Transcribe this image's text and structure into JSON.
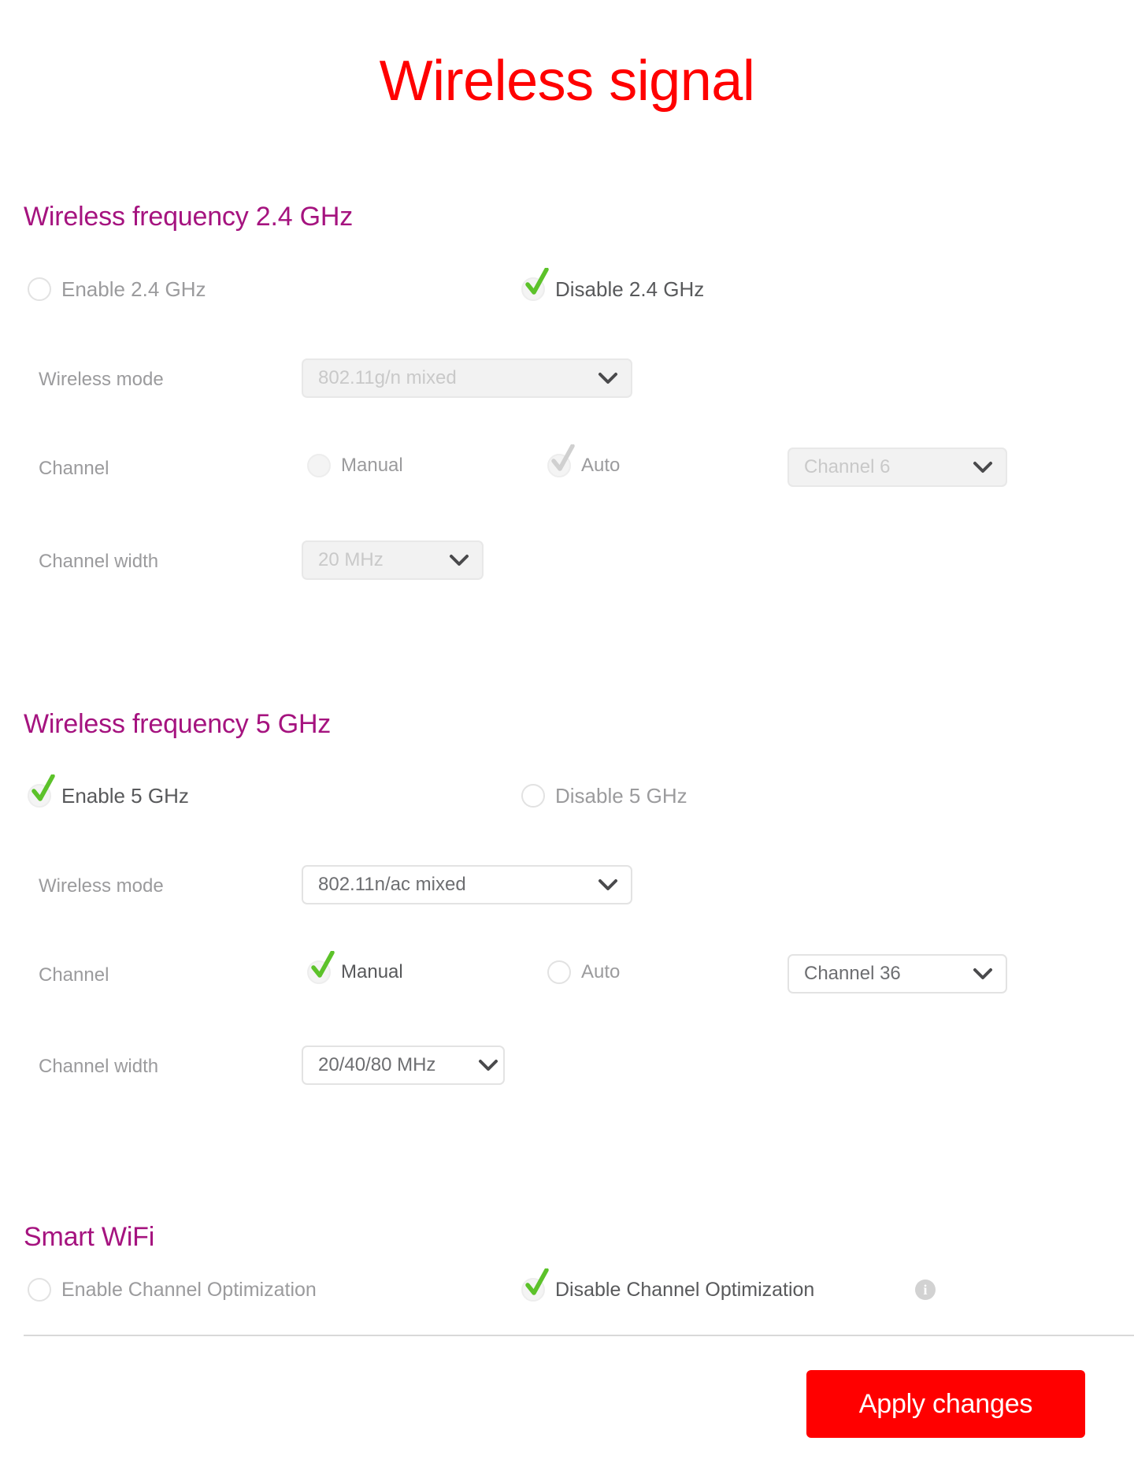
{
  "page": {
    "title": "Wireless signal"
  },
  "colors": {
    "title_red": "#ff0000",
    "heading_magenta": "#a5137f",
    "label_gray": "#58595b",
    "disabled_gray": "#c9c9c9",
    "check_green": "#5cc22a",
    "check_disabled": "#d0d0d0",
    "button_red": "#ff0000"
  },
  "band24": {
    "heading": "Wireless frequency 2.4 GHz",
    "enable_label": "Enable 2.4 GHz",
    "enable_selected": false,
    "disable_label": "Disable 2.4 GHz",
    "disable_selected": true,
    "wireless_mode_label": "Wireless mode",
    "wireless_mode_value": "802.11g/n mixed",
    "channel_label": "Channel",
    "manual_label": "Manual",
    "manual_selected": false,
    "auto_label": "Auto",
    "auto_selected": true,
    "channel_value": "Channel 6",
    "channel_width_label": "Channel width",
    "channel_width_value": "20 MHz"
  },
  "band5": {
    "heading": "Wireless frequency 5 GHz",
    "enable_label": "Enable 5 GHz",
    "enable_selected": true,
    "disable_label": "Disable 5 GHz",
    "disable_selected": false,
    "wireless_mode_label": "Wireless mode",
    "wireless_mode_value": "802.11n/ac mixed",
    "channel_label": "Channel",
    "manual_label": "Manual",
    "manual_selected": true,
    "auto_label": "Auto",
    "auto_selected": false,
    "channel_value": "Channel 36",
    "channel_width_label": "Channel width",
    "channel_width_value": "20/40/80 MHz"
  },
  "smart_wifi": {
    "heading": "Smart WiFi",
    "enable_label": "Enable Channel Optimization",
    "enable_selected": false,
    "disable_label": "Disable Channel Optimization",
    "disable_selected": true,
    "info_icon": "info-icon",
    "info_glyph": "i"
  },
  "footer": {
    "apply_label": "Apply changes"
  }
}
